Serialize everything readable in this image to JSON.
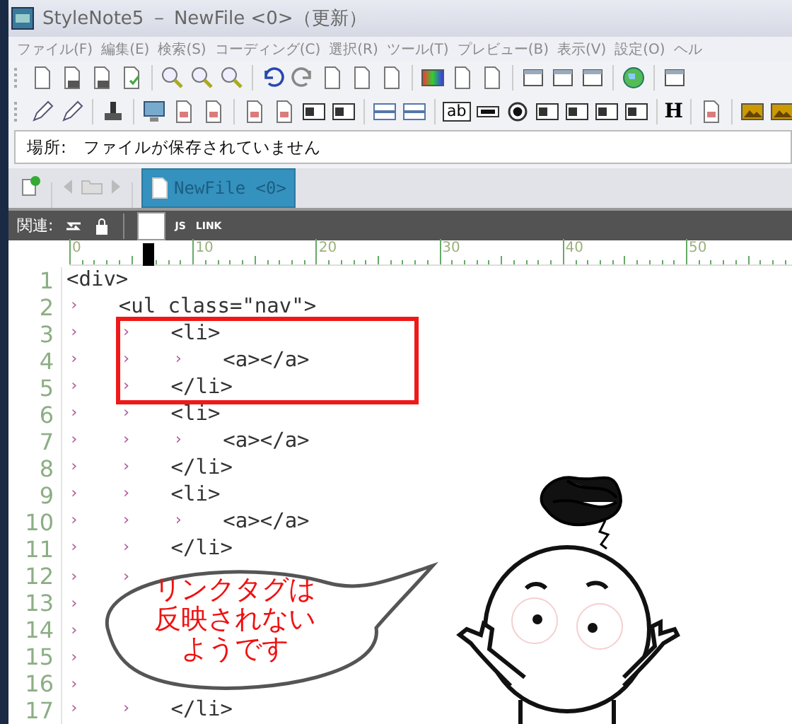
{
  "window": {
    "title": "StyleNote5 － NewFile <0>（更新）"
  },
  "menu": [
    "ファイル(F)",
    "編集(E)",
    "検索(S)",
    "コーディング(C)",
    "選択(R)",
    "ツール(T)",
    "プレビュー(B)",
    "表示(V)",
    "設定(O)",
    "ヘル"
  ],
  "toolbar_2": {
    "text_field_label": "ab",
    "heading_label": "H"
  },
  "location": {
    "label": "場所:",
    "value": "ファイルが保存されていません"
  },
  "tabs": [
    {
      "label": "NewFile <0>",
      "selected": true
    }
  ],
  "related_bar": {
    "label": "関連:",
    "js": "JS",
    "link": "LINK"
  },
  "ruler": {
    "labels": [
      "0",
      "10",
      "20",
      "30",
      "40",
      "50"
    ]
  },
  "lines": [
    {
      "number": "1",
      "code": "<div>"
    },
    {
      "number": "2",
      "markers": [
        "›"
      ],
      "code": "<ul class=\"nav\">"
    },
    {
      "number": "3",
      "markers": [
        "›",
        "›"
      ],
      "code": "<li>"
    },
    {
      "number": "4",
      "markers": [
        "›",
        "›",
        "›"
      ],
      "code": "<a></a>"
    },
    {
      "number": "5",
      "markers": [
        "›",
        "›"
      ],
      "code": "</li>"
    },
    {
      "number": "6",
      "markers": [
        "›",
        "›"
      ],
      "code": "<li>"
    },
    {
      "number": "7",
      "markers": [
        "›",
        "›",
        "›"
      ],
      "code": "<a></a>"
    },
    {
      "number": "8",
      "markers": [
        "›",
        "›"
      ],
      "code": "</li>"
    },
    {
      "number": "9",
      "markers": [
        "›",
        "›"
      ],
      "code": "<li>"
    },
    {
      "number": "10",
      "markers": [
        "›",
        "›",
        "›"
      ],
      "code": "<a></a>"
    },
    {
      "number": "11",
      "markers": [
        "›",
        "›"
      ],
      "code": "</li>"
    },
    {
      "number": "12",
      "markers": [
        "›",
        "›"
      ]
    },
    {
      "number": "13",
      "markers": [
        "›"
      ]
    },
    {
      "number": "14",
      "markers": [
        "›"
      ]
    },
    {
      "number": "15",
      "markers": [
        "›"
      ]
    },
    {
      "number": "16",
      "markers": [
        "›"
      ]
    },
    {
      "number": "17",
      "markers": [
        "›",
        "›"
      ],
      "code": "</li>"
    }
  ],
  "bubble": {
    "lines": [
      "リンクタグは",
      "反映されない",
      "ようです"
    ]
  }
}
